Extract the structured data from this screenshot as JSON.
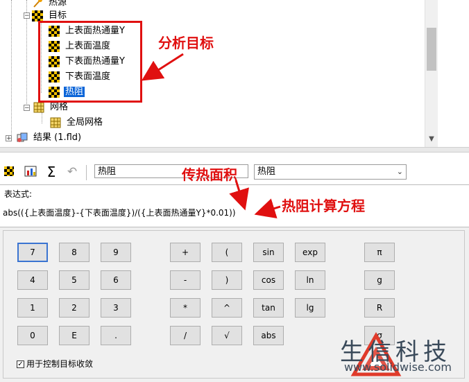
{
  "tree": {
    "items": [
      {
        "label": "热源",
        "icon": "heat-source-icon"
      },
      {
        "label": "目标",
        "icon": "goals-folder-icon"
      },
      {
        "label": "上表面热通量Y",
        "icon": "goal-flag-icon"
      },
      {
        "label": "上表面温度",
        "icon": "goal-flag-icon"
      },
      {
        "label": "下表面热通量Y",
        "icon": "goal-flag-icon"
      },
      {
        "label": "下表面温度",
        "icon": "goal-flag-icon"
      },
      {
        "label": "热阻",
        "icon": "equation-goal-icon"
      },
      {
        "label": "网格",
        "icon": "mesh-icon"
      },
      {
        "label": "全局网格",
        "icon": "mesh-icon"
      },
      {
        "label": "结果 (1.fld)",
        "icon": "results-icon"
      }
    ]
  },
  "toolbar": {
    "name_value": "热阻",
    "unit_value": "热阻",
    "icons": [
      "goal-flag-icon",
      "chart-icon",
      "sigma-icon",
      "undo-icon"
    ]
  },
  "expression": {
    "label": "表达式:",
    "text": "abs(({上表面温度}-{下表面温度})/({上表面热通量Y}*0.01))"
  },
  "keypad": {
    "keys": [
      "7",
      "8",
      "9",
      "+",
      "(",
      "sin",
      "exp",
      "π",
      "4",
      "5",
      "6",
      "-",
      ")",
      "cos",
      "ln",
      "g",
      "1",
      "2",
      "3",
      "*",
      "^",
      "tan",
      "lg",
      "R",
      "0",
      "E",
      ".",
      "/",
      "√",
      "abs",
      "σ"
    ]
  },
  "converge": {
    "label": "用于控制目标收敛",
    "checked": true,
    "check_glyph": "✓"
  },
  "annotations": {
    "analysis_goals": "分析目标",
    "heat_transfer_area": "传热面积",
    "thermal_resistance_eq": "热阻计算方程"
  },
  "logo": {
    "name": "生信科技",
    "url": "www.solidwise.com"
  },
  "colors": {
    "annotation": "#e01010",
    "selection": "#0a64d8",
    "logo_red": "#e03a2a"
  }
}
